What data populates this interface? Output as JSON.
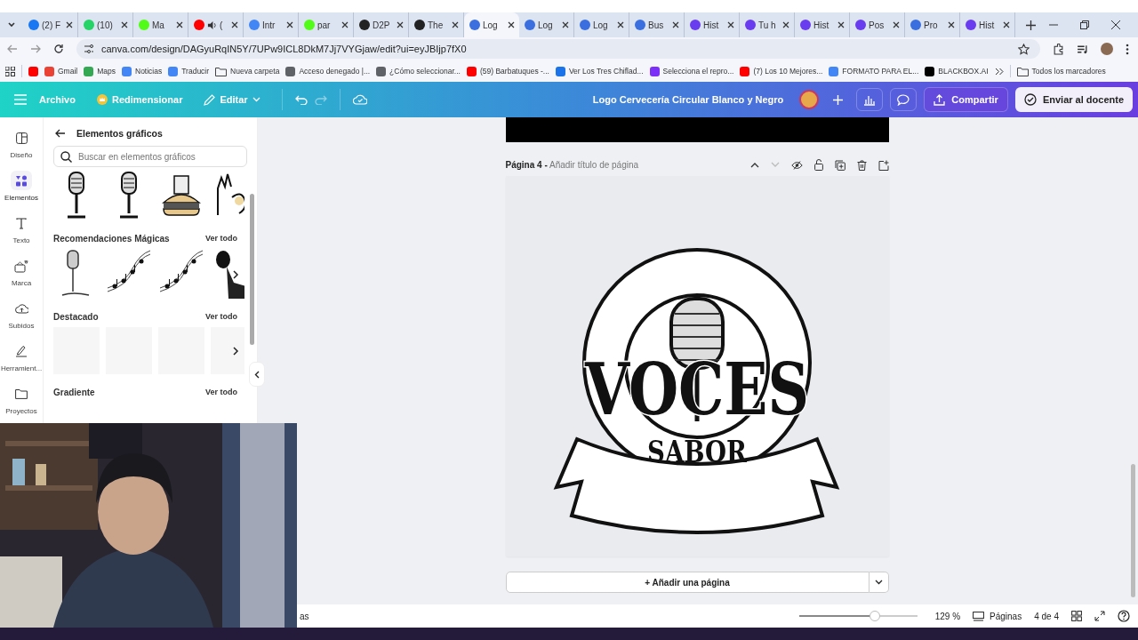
{
  "browser": {
    "tabs": [
      {
        "label": "(2) F",
        "color": "#1877f2",
        "audio": false,
        "selected": false
      },
      {
        "label": "(10)",
        "color": "#25d366",
        "audio": false,
        "selected": false
      },
      {
        "label": "Ma",
        "color": "#53fc18",
        "audio": false,
        "selected": false
      },
      {
        "label": "(",
        "color": "#ff0000",
        "audio": true,
        "selected": false
      },
      {
        "label": "Intr",
        "color": "#4285f4",
        "audio": false,
        "selected": false
      },
      {
        "label": "par",
        "color": "#53fc18",
        "audio": false,
        "selected": false
      },
      {
        "label": "D2P",
        "color": "#222222",
        "audio": false,
        "selected": false
      },
      {
        "label": "The",
        "color": "#222222",
        "audio": false,
        "selected": false
      },
      {
        "label": "Log",
        "color": "#3b6fe0",
        "audio": false,
        "selected": true
      },
      {
        "label": "Log",
        "color": "#3b6fe0",
        "audio": false,
        "selected": false
      },
      {
        "label": "Log",
        "color": "#3b6fe0",
        "audio": false,
        "selected": false
      },
      {
        "label": "Bus",
        "color": "#3b6fe0",
        "audio": false,
        "selected": false
      },
      {
        "label": "Hist",
        "color": "#6a3cf0",
        "audio": false,
        "selected": false
      },
      {
        "label": "Tu h",
        "color": "#6a3cf0",
        "audio": false,
        "selected": false
      },
      {
        "label": "Hist",
        "color": "#6a3cf0",
        "audio": false,
        "selected": false
      },
      {
        "label": "Pos",
        "color": "#6a3cf0",
        "audio": false,
        "selected": false
      },
      {
        "label": "Pro",
        "color": "#3b6fe0",
        "audio": false,
        "selected": false
      },
      {
        "label": "Hist",
        "color": "#6a3cf0",
        "audio": false,
        "selected": false
      }
    ],
    "url": "canva.com/design/DAGyuRqIN5Y/7UPw9ICL8DkM7Jj7VYGjaw/edit?ui=eyJBIjp7fX0",
    "bookmarks": [
      {
        "kind": "site",
        "color": "#ff0000"
      },
      {
        "kind": "site",
        "label": "Gmail",
        "color": "#ea4335"
      },
      {
        "kind": "site",
        "label": "Maps",
        "color": "#34a853"
      },
      {
        "kind": "site",
        "label": "Noticias",
        "color": "#4285f4"
      },
      {
        "kind": "site",
        "label": "Traducir",
        "color": "#4285f4"
      },
      {
        "kind": "folder",
        "label": "Nueva carpeta"
      },
      {
        "kind": "site",
        "label": "Acceso denegado |...",
        "color": "#5f6368"
      },
      {
        "kind": "site",
        "label": "¿Cómo seleccionar...",
        "color": "#5f6368"
      },
      {
        "kind": "site",
        "label": "(59) Barbatuques -...",
        "color": "#ff0000"
      },
      {
        "kind": "site",
        "label": "Ver Los Tres Chiflad...",
        "color": "#1a73e8"
      },
      {
        "kind": "site",
        "label": "Selecciona el repro...",
        "color": "#7b2ff7"
      },
      {
        "kind": "site",
        "label": "(7) Los 10 Mejores...",
        "color": "#ff0000"
      },
      {
        "kind": "site",
        "label": "FORMATO PARA EL...",
        "color": "#4285f4"
      },
      {
        "kind": "site",
        "label": "BLACKBOX.AI",
        "color": "#000000"
      }
    ],
    "all_bookmarks": "Todos los marcadores"
  },
  "toolbar": {
    "file": "Archivo",
    "resize": "Redimensionar",
    "edit": "Editar",
    "title": "Logo Cervecería Circular Blanco y Negro",
    "share": "Compartir",
    "submit": "Enviar al docente"
  },
  "rail": [
    {
      "label": "Diseño",
      "selected": false
    },
    {
      "label": "Elementos",
      "selected": true
    },
    {
      "label": "Texto",
      "selected": false
    },
    {
      "label": "Marca",
      "selected": false
    },
    {
      "label": "Subidos",
      "selected": false
    },
    {
      "label": "Herramient...",
      "selected": false
    },
    {
      "label": "Proyectos",
      "selected": false
    }
  ],
  "panel": {
    "title": "Elementos gráficos",
    "search_placeholder": "Buscar en elementos gráficos",
    "top_row": [
      {
        "kind": "microphone"
      },
      {
        "kind": "microphone"
      },
      {
        "kind": "burger"
      },
      {
        "kind": "hand"
      }
    ],
    "sections": [
      {
        "title": "Recomendaciones Mágicas",
        "link": "Ver todo",
        "items": [
          {
            "kind": "microphone"
          },
          {
            "kind": "notes"
          },
          {
            "kind": "notes"
          },
          {
            "kind": "singer"
          }
        ]
      },
      {
        "title": "Destacado",
        "link": "Ver todo",
        "items": [
          {
            "kind": "blank"
          },
          {
            "kind": "blank"
          },
          {
            "kind": "blank"
          },
          {
            "kind": "blank"
          }
        ]
      },
      {
        "title": "Gradiente",
        "link": "Ver todo"
      }
    ]
  },
  "page": {
    "label": "Página 4 -",
    "title_placeholder": "Añadir título de página",
    "design": {
      "title": "VOCES",
      "subtitle": "SABOR"
    }
  },
  "add_page": "+ Añadir una página",
  "footer": {
    "notes": "as",
    "zoom": {
      "level": 0.64
    },
    "zoom_reading": "129 %",
    "pages": "Páginas",
    "page_count": "4 de 4"
  }
}
